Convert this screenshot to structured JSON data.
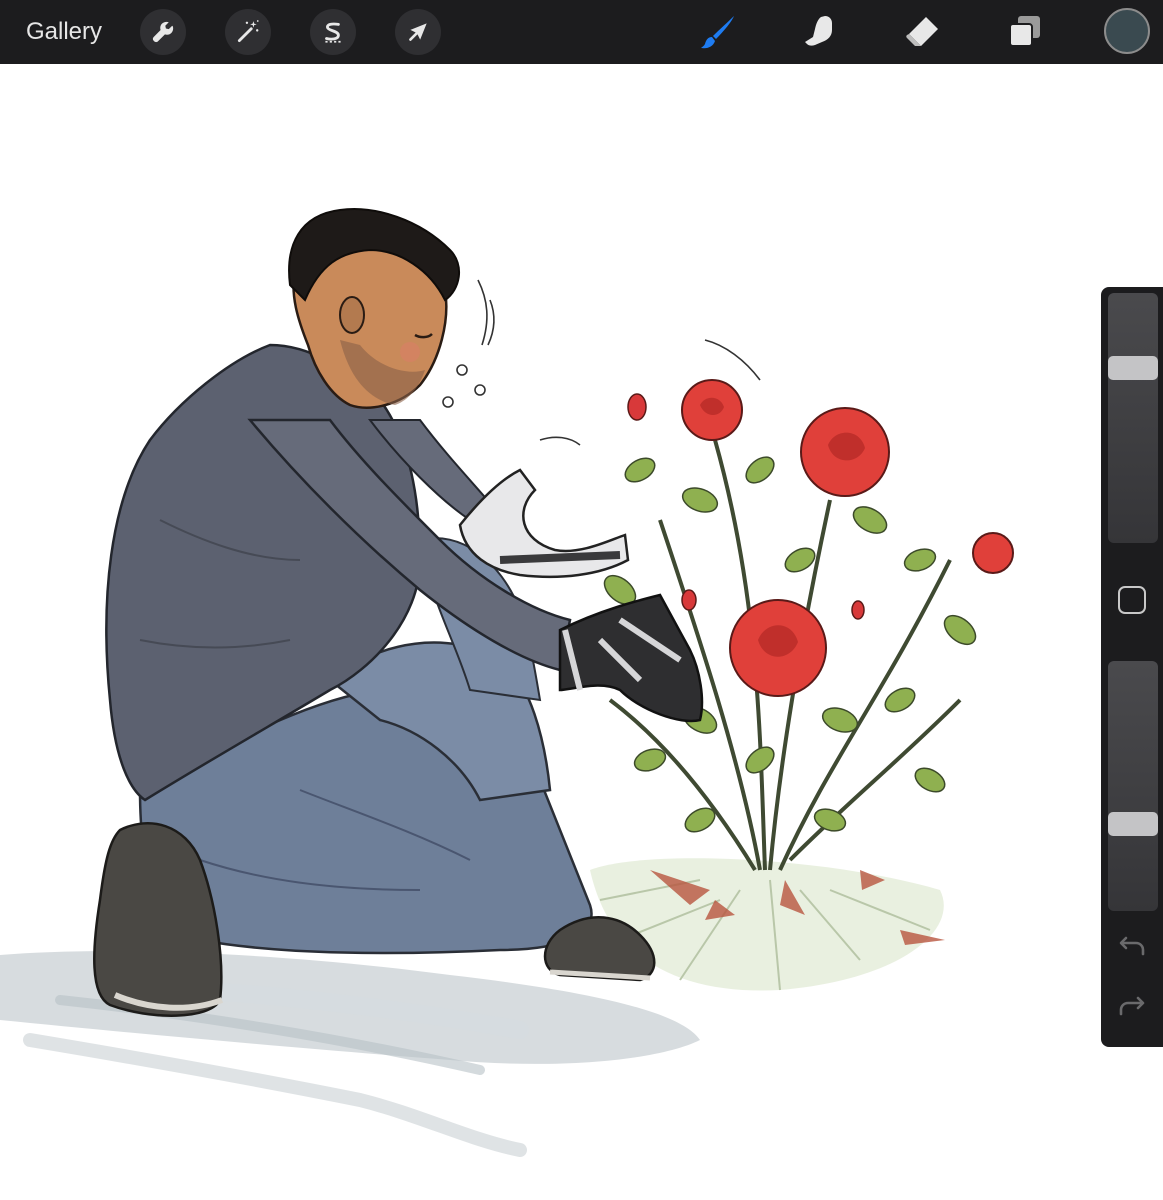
{
  "app": {
    "gallery_label": "Gallery"
  },
  "toolbar": {
    "left_tools": [
      {
        "name": "actions",
        "icon": "wrench-icon"
      },
      {
        "name": "adjustments",
        "icon": "magic-wand-icon"
      },
      {
        "name": "selection",
        "icon": "selection-s-icon"
      },
      {
        "name": "transform",
        "icon": "arrow-cursor-icon"
      }
    ],
    "right_tools": [
      {
        "name": "brush",
        "icon": "brush-icon",
        "active": true
      },
      {
        "name": "smudge",
        "icon": "smudge-finger-icon",
        "active": false
      },
      {
        "name": "eraser",
        "icon": "eraser-icon",
        "active": false
      },
      {
        "name": "layers",
        "icon": "layers-icon",
        "active": false
      }
    ],
    "active_color": "#3a4a50",
    "accent_color": "#1e7cf2"
  },
  "sidebar": {
    "brush_size_level": 0.72,
    "opacity_level": 0.33,
    "modify_icon": "square-outline-icon",
    "undo_icon": "undo-icon",
    "redo_icon": "redo-icon"
  },
  "canvas": {
    "content": "illustration-kneeling-man-with-roses"
  }
}
